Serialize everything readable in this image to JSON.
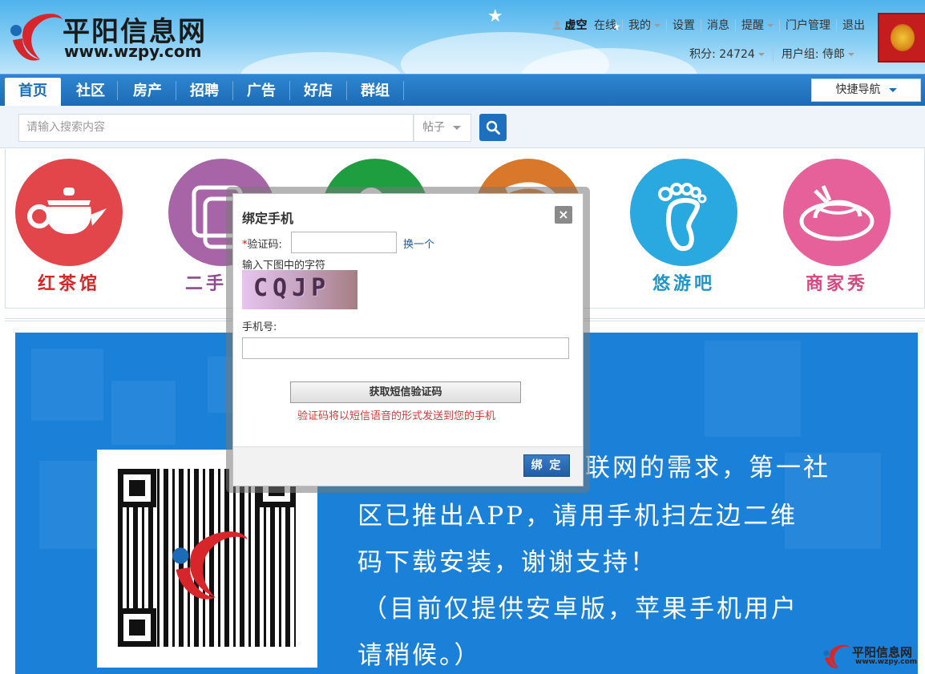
{
  "site": {
    "title": "平阳信息网",
    "url": "www.wzpy.com"
  },
  "userbar": {
    "username": "虚空",
    "status": "在线",
    "mine": "我的",
    "settings": "设置",
    "messages": "消息",
    "reminders": "提醒",
    "portal_admin": "门户管理",
    "logout": "退出",
    "points": "积分: 24724",
    "usergroup": "用户组: 侍郎"
  },
  "nav": {
    "items": [
      "首页",
      "社区",
      "房产",
      "招聘",
      "广告",
      "好店",
      "群组"
    ],
    "active": "首页",
    "quick_nav": "快捷导航"
  },
  "search": {
    "placeholder": "请输入搜索内容",
    "type": "帖子"
  },
  "categories": [
    {
      "label": "红茶馆",
      "color": "#e2454a",
      "label_color": "#d62828",
      "icon": "teapot-icon"
    },
    {
      "label": "二手",
      "color": "#a765a8",
      "label_color": "#8e4a8e",
      "icon": "sofa-icon"
    },
    {
      "label": "",
      "color": "#1e9e3e",
      "label_color": "#1e9e3e",
      "icon": "cloud-icon"
    },
    {
      "label": "",
      "color": "#d9782a",
      "label_color": "#d9782a",
      "icon": "chat-icon"
    },
    {
      "label": "悠游吧",
      "color": "#2aa9e0",
      "label_color": "#1f95c9",
      "icon": "footprint-icon"
    },
    {
      "label": "商家秀",
      "color": "#e6609a",
      "label_color": "#d54880",
      "icon": "hat-icon"
    }
  ],
  "banner": {
    "lines": [
      "联网的需求，第一社",
      "区已推出APP，请用手机扫左边二维",
      "码下载安装，谢谢支持！",
      "（目前仅提供安卓版，苹果手机用户",
      "请稍候。）"
    ],
    "watermark_title": "平阳信息网",
    "watermark_url": "www.wzpy.com"
  },
  "modal": {
    "title": "绑定手机",
    "code_label": "验证码:",
    "required_mark": "*",
    "change_link": "换一个",
    "captcha_hint": "输入下图中的字符",
    "captcha_text": "CQJP",
    "phone_label": "手机号:",
    "sms_button": "获取短信验证码",
    "sms_note": "验证码将以短信语音的形式发送到您的手机",
    "bind_button": "绑 定",
    "close": "×"
  }
}
